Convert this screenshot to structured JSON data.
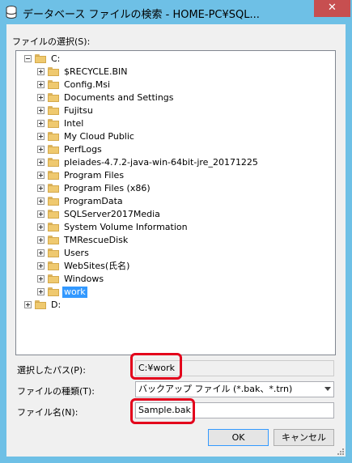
{
  "window": {
    "title": "データベース ファイルの検索 - HOME-PC¥SQL...",
    "close_glyph": "✕"
  },
  "tree_section": {
    "label": "ファイルの選択(S):"
  },
  "tree": {
    "roots": [
      {
        "label": "C:",
        "expanded": true,
        "children": [
          {
            "label": "$RECYCLE.BIN"
          },
          {
            "label": "Config.Msi"
          },
          {
            "label": "Documents and Settings"
          },
          {
            "label": "Fujitsu"
          },
          {
            "label": "Intel"
          },
          {
            "label": "My Cloud Public"
          },
          {
            "label": "PerfLogs"
          },
          {
            "label": "pleiades-4.7.2-java-win-64bit-jre_20171225"
          },
          {
            "label": "Program Files"
          },
          {
            "label": "Program Files (x86)"
          },
          {
            "label": "ProgramData"
          },
          {
            "label": "SQLServer2017Media"
          },
          {
            "label": "System Volume Information"
          },
          {
            "label": "TMRescueDisk"
          },
          {
            "label": "Users"
          },
          {
            "label": "WebSites(氏名)"
          },
          {
            "label": "Windows"
          },
          {
            "label": "work",
            "selected": true
          }
        ]
      },
      {
        "label": "D:",
        "expanded": false,
        "children": []
      }
    ]
  },
  "form": {
    "path_label": "選択したパス(P):",
    "path_value": "C:¥work",
    "type_label": "ファイルの種類(T):",
    "type_value": "バックアップ ファイル (*.bak、*.trn)",
    "name_label": "ファイル名(N):",
    "name_value": "Sample.bak"
  },
  "buttons": {
    "ok": "OK",
    "cancel": "キャンセル"
  },
  "colors": {
    "titlebar": "#6ec0e6",
    "close": "#c74f50",
    "selection": "#3399ff",
    "annotation": "#e3001b"
  }
}
